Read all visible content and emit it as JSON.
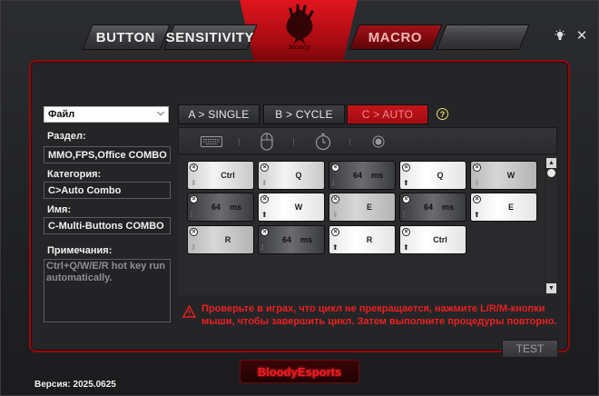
{
  "top_tabs": {
    "button": "BUTTON",
    "sensitivity": "SENSITIVITY",
    "macro": "MACRO"
  },
  "logo_text": "bloody",
  "left": {
    "file_select": "Файл",
    "section_label": "Раздел:",
    "section_value": "MMO,FPS,Office COMBO E>",
    "category_label": "Категория:",
    "category_value": "C>Auto Combo",
    "name_label": "Имя:",
    "name_value": "C-Multi-Buttons COMBO",
    "notes_label": "Примечания:",
    "notes_value": "Ctrl+Q/W/E/R hot key run automatically."
  },
  "mode_tabs": {
    "single": "A > SINGLE",
    "cycle": "B > CYCLE",
    "auto": "C > AUTO",
    "help": "?"
  },
  "toolbar_icons": [
    "keyboard-icon",
    "mouse-icon",
    "stopwatch-icon",
    "record-icon"
  ],
  "steps": [
    {
      "type": "key",
      "label": "Ctrl",
      "direction": "down"
    },
    {
      "type": "key",
      "label": "Q",
      "direction": "down"
    },
    {
      "type": "delay",
      "value": "64",
      "unit": "ms"
    },
    {
      "type": "key",
      "label": "Q",
      "direction": "up"
    },
    {
      "type": "key",
      "label": "W",
      "direction": "down"
    },
    {
      "type": "delay",
      "value": "64",
      "unit": "ms"
    },
    {
      "type": "key",
      "label": "W",
      "direction": "up"
    },
    {
      "type": "key",
      "label": "E",
      "direction": "down"
    },
    {
      "type": "delay",
      "value": "64",
      "unit": "ms"
    },
    {
      "type": "key",
      "label": "E",
      "direction": "up"
    },
    {
      "type": "key",
      "label": "R",
      "direction": "down"
    },
    {
      "type": "delay",
      "value": "64",
      "unit": "ms"
    },
    {
      "type": "key",
      "label": "R",
      "direction": "up"
    },
    {
      "type": "key",
      "label": "Ctrl",
      "direction": "up"
    }
  ],
  "warning": "Проверьте в играх, что цикл не прекращается, нажмите L/R/M-кнопки мыши, чтобы завершить цикл. Затем выполните процедуры повторно.",
  "test_button": "TEST",
  "brand": "BloodyEsports",
  "version": "Версия: 2025.0625",
  "colors": {
    "accent": "#c4141b",
    "warning": "#e82020",
    "help": "#e7e36a"
  }
}
